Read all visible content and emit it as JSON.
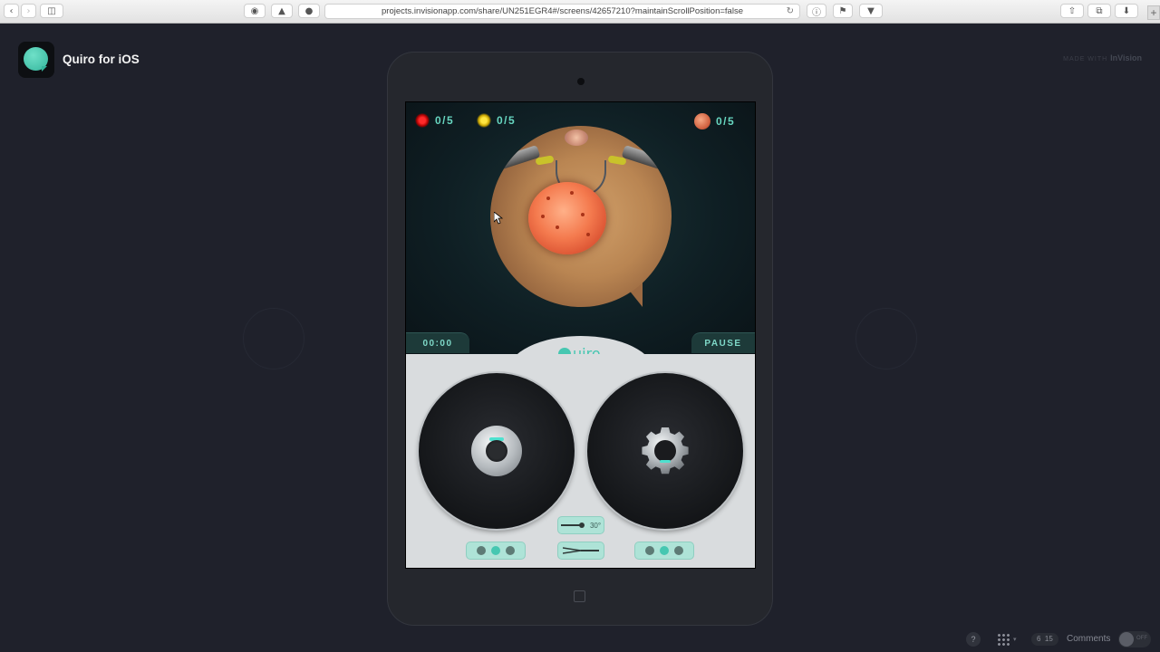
{
  "browser": {
    "url": "projects.invisionapp.com/share/UN251EGR4#/screens/42657210?maintainScrollPosition=false"
  },
  "header": {
    "app_title": "Quiro for iOS",
    "made_with": "MADE WITH",
    "brand": "InVision"
  },
  "game": {
    "hud": [
      {
        "icon": "red-burst-icon",
        "count": "0/5"
      },
      {
        "icon": "yellow-burst-icon",
        "count": "0/5"
      },
      {
        "icon": "tumor-icon",
        "count": "0/5"
      }
    ],
    "timer": "00:00",
    "pause_label": "PAUSE",
    "logo": "uiro",
    "angle": "30°",
    "left_dots_active": 2,
    "right_dots_active": 2
  },
  "footer": {
    "help": "?",
    "page_current": "6",
    "page_total": "15",
    "comments_label": "Comments",
    "toggle_label": "OFF"
  },
  "colors": {
    "accent": "#46c7b1",
    "background": "#1f212b"
  }
}
